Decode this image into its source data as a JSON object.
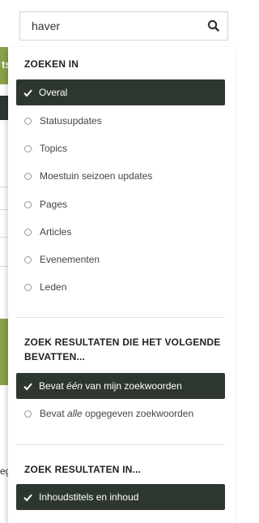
{
  "background": {
    "green_bar_text": "ts",
    "bottom_text": "eg"
  },
  "search": {
    "value": "haver",
    "search_icon": "search-icon"
  },
  "sections": {
    "search_in": {
      "title": "ZOEKEN IN",
      "options": [
        {
          "label": "Overal",
          "selected": true
        },
        {
          "label": "Statusupdates",
          "selected": false
        },
        {
          "label": "Topics",
          "selected": false
        },
        {
          "label": "Moestuin seizoen updates",
          "selected": false
        },
        {
          "label": "Pages",
          "selected": false
        },
        {
          "label": "Articles",
          "selected": false
        },
        {
          "label": "Evenementen",
          "selected": false
        },
        {
          "label": "Leden",
          "selected": false
        }
      ]
    },
    "contains": {
      "title_line1": "ZOEK RESULTATEN DIE HET VOLGENDE",
      "title_line2": "BEVATTEN...",
      "options": [
        {
          "prefix": "Bevat ",
          "em": "één",
          "suffix": " van mijn zoekwoorden",
          "selected": true
        },
        {
          "prefix": "Bevat ",
          "em": "alle",
          "suffix": " opgegeven zoekwoorden",
          "selected": false
        }
      ]
    },
    "results_in": {
      "title": "ZOEK RESULTATEN IN...",
      "options": [
        {
          "label": "Inhoudstitels en inhoud",
          "selected": true
        }
      ]
    }
  },
  "colors": {
    "selected_bg": "#2d3730",
    "accent_green": "#8aa24a"
  }
}
